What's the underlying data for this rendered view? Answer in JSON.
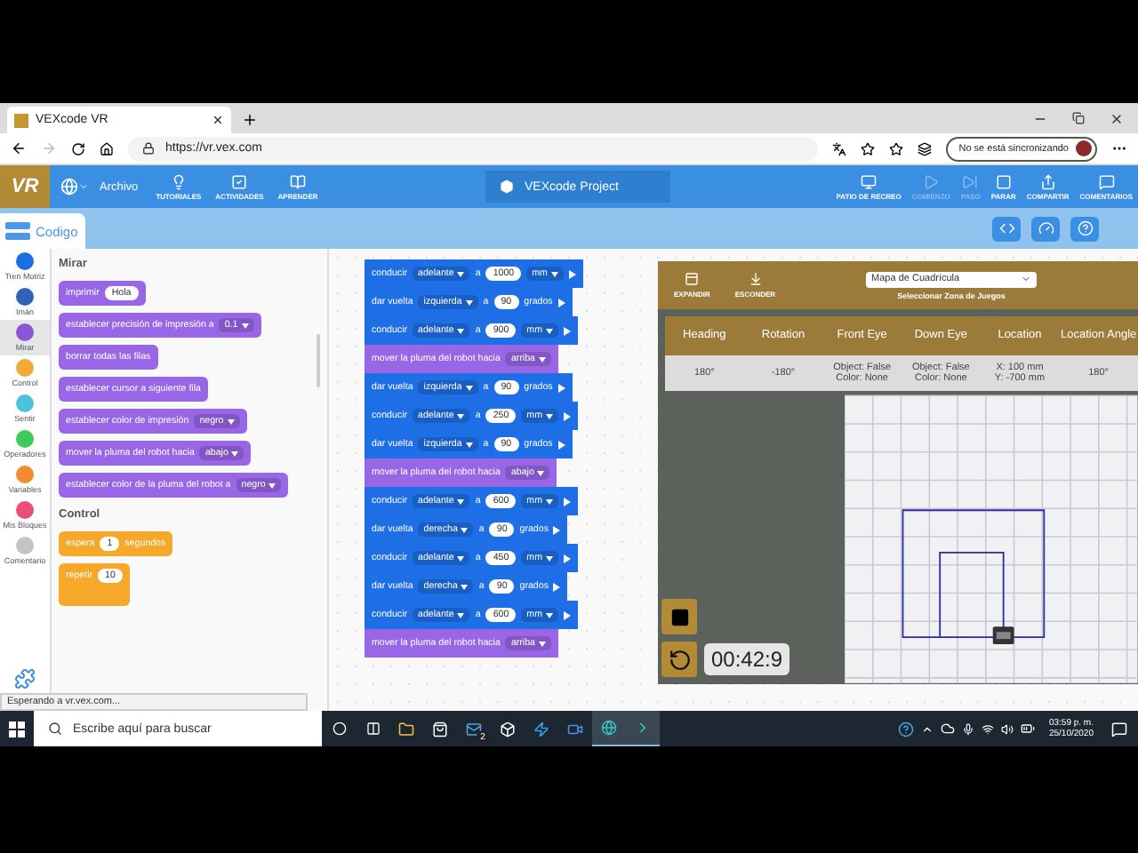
{
  "browser": {
    "tab_title": "VEXcode VR",
    "url": "https://vr.vex.com",
    "sync_label": "No se está sincronizando"
  },
  "toolbar": {
    "logo": "VR",
    "file_menu": "Archivo",
    "nav": [
      {
        "label": "TUTORIALES"
      },
      {
        "label": "ACTIVIDADES"
      },
      {
        "label": "APRENDER"
      }
    ],
    "project": "VEXcode Project",
    "actions": [
      {
        "label": "PATIO DE RECREO",
        "disabled": false
      },
      {
        "label": "COMIENZO",
        "disabled": true
      },
      {
        "label": "PASO",
        "disabled": true
      },
      {
        "label": "PARAR",
        "disabled": false
      },
      {
        "label": "COMPARTIR",
        "disabled": false
      },
      {
        "label": "COMENTARIOS",
        "disabled": false
      }
    ]
  },
  "code_tab": "Codigo",
  "categories": [
    {
      "label": "Tren Motriz",
      "color": "#1c6fe3",
      "selected": false
    },
    {
      "label": "Imán",
      "color": "#2f63b8",
      "selected": false
    },
    {
      "label": "Mirar",
      "color": "#8a55d7",
      "selected": true
    },
    {
      "label": "Control",
      "color": "#f2a93b",
      "selected": false
    },
    {
      "label": "Sentir",
      "color": "#4cc3dc",
      "selected": false
    },
    {
      "label": "Operadores",
      "color": "#3ecb57",
      "selected": false
    },
    {
      "label": "Variables",
      "color": "#f28a2e",
      "selected": false
    },
    {
      "label": "Mis Bloques",
      "color": "#e94f7a",
      "selected": false
    },
    {
      "label": "Comentario",
      "color": "#c4c4c4",
      "selected": false
    }
  ],
  "palette": [
    {
      "title": "Mirar",
      "blocks": [
        {
          "kind": "stack",
          "color": "#9966e6",
          "parts": [
            {
              "kind": "text",
              "text": "imprimir"
            },
            {
              "kind": "input",
              "text": "Hola"
            }
          ]
        },
        {
          "kind": "stack",
          "color": "#9966e6",
          "parts": [
            {
              "kind": "text",
              "text": "establecer precisión de impresión a"
            },
            {
              "kind": "dropdown",
              "text": "0.1"
            }
          ]
        },
        {
          "kind": "stack",
          "color": "#9966e6",
          "parts": [
            {
              "kind": "text",
              "text": "borrar todas las filas"
            }
          ]
        },
        {
          "kind": "stack",
          "color": "#9966e6",
          "parts": [
            {
              "kind": "text",
              "text": "establecer cursor a siguiente fila"
            }
          ]
        },
        {
          "kind": "stack",
          "color": "#9966e6",
          "parts": [
            {
              "kind": "text",
              "text": "establecer color de impresión"
            },
            {
              "kind": "dropdown",
              "text": "negro"
            }
          ]
        },
        {
          "kind": "stack",
          "color": "#9966e6",
          "parts": [
            {
              "kind": "text",
              "text": "mover la pluma del robot hacia"
            },
            {
              "kind": "dropdown",
              "text": "abajo"
            }
          ]
        },
        {
          "kind": "stack",
          "color": "#9966e6",
          "parts": [
            {
              "kind": "text",
              "text": "establecer color de la pluma del robot a"
            },
            {
              "kind": "dropdown",
              "text": "negro"
            }
          ]
        }
      ]
    },
    {
      "title": "Control",
      "blocks": [
        {
          "kind": "stack",
          "color": "#f5a829",
          "parts": [
            {
              "kind": "text",
              "text": "espera"
            },
            {
              "kind": "input",
              "text": "1"
            },
            {
              "kind": "text",
              "text": "segundos"
            }
          ]
        },
        {
          "kind": "c-block",
          "color": "#f5a829",
          "parts": [
            {
              "kind": "text",
              "text": "repetir"
            },
            {
              "kind": "input",
              "text": "10"
            }
          ]
        }
      ]
    }
  ],
  "script": [
    {
      "color": "#1e6fe6",
      "parts": [
        {
          "kind": "text",
          "text": "conducir"
        },
        {
          "kind": "dropdown",
          "text": "adelante"
        },
        {
          "kind": "text",
          "text": "a"
        },
        {
          "kind": "input",
          "text": "1000"
        },
        {
          "kind": "dropdown",
          "text": "mm"
        },
        {
          "kind": "arrow"
        }
      ]
    },
    {
      "color": "#1e6fe6",
      "parts": [
        {
          "kind": "text",
          "text": "dar vuelta"
        },
        {
          "kind": "dropdown",
          "text": "izquierda"
        },
        {
          "kind": "text",
          "text": "a"
        },
        {
          "kind": "input",
          "text": "90"
        },
        {
          "kind": "text",
          "text": "grados"
        },
        {
          "kind": "arrow"
        }
      ]
    },
    {
      "color": "#1e6fe6",
      "parts": [
        {
          "kind": "text",
          "text": "conducir"
        },
        {
          "kind": "dropdown",
          "text": "adelante"
        },
        {
          "kind": "text",
          "text": "a"
        },
        {
          "kind": "input",
          "text": "900"
        },
        {
          "kind": "dropdown",
          "text": "mm"
        },
        {
          "kind": "arrow"
        }
      ]
    },
    {
      "color": "#9966e6",
      "parts": [
        {
          "kind": "text",
          "text": "mover la pluma del robot hacia"
        },
        {
          "kind": "dropdown",
          "text": "arriba"
        }
      ]
    },
    {
      "color": "#1e6fe6",
      "parts": [
        {
          "kind": "text",
          "text": "dar vuelta"
        },
        {
          "kind": "dropdown",
          "text": "izquierda"
        },
        {
          "kind": "text",
          "text": "a"
        },
        {
          "kind": "input",
          "text": "90"
        },
        {
          "kind": "text",
          "text": "grados"
        },
        {
          "kind": "arrow"
        }
      ]
    },
    {
      "color": "#1e6fe6",
      "parts": [
        {
          "kind": "text",
          "text": "conducir"
        },
        {
          "kind": "dropdown",
          "text": "adelante"
        },
        {
          "kind": "text",
          "text": "a"
        },
        {
          "kind": "input",
          "text": "250"
        },
        {
          "kind": "dropdown",
          "text": "mm"
        },
        {
          "kind": "arrow"
        }
      ]
    },
    {
      "color": "#1e6fe6",
      "parts": [
        {
          "kind": "text",
          "text": "dar vuelta"
        },
        {
          "kind": "dropdown",
          "text": "izquierda"
        },
        {
          "kind": "text",
          "text": "a"
        },
        {
          "kind": "input",
          "text": "90"
        },
        {
          "kind": "text",
          "text": "grados"
        },
        {
          "kind": "arrow"
        }
      ]
    },
    {
      "color": "#9966e6",
      "parts": [
        {
          "kind": "text",
          "text": "mover la pluma del robot hacia"
        },
        {
          "kind": "dropdown",
          "text": "abajo"
        }
      ]
    },
    {
      "color": "#1e6fe6",
      "parts": [
        {
          "kind": "text",
          "text": "conducir"
        },
        {
          "kind": "dropdown",
          "text": "adelante"
        },
        {
          "kind": "text",
          "text": "a"
        },
        {
          "kind": "input",
          "text": "600"
        },
        {
          "kind": "dropdown",
          "text": "mm"
        },
        {
          "kind": "arrow"
        }
      ]
    },
    {
      "color": "#1e6fe6",
      "parts": [
        {
          "kind": "text",
          "text": "dar vuelta"
        },
        {
          "kind": "dropdown",
          "text": "derecha"
        },
        {
          "kind": "text",
          "text": "a"
        },
        {
          "kind": "input",
          "text": "90"
        },
        {
          "kind": "text",
          "text": "grados"
        },
        {
          "kind": "arrow"
        }
      ]
    },
    {
      "color": "#1e6fe6",
      "parts": [
        {
          "kind": "text",
          "text": "conducir"
        },
        {
          "kind": "dropdown",
          "text": "adelante"
        },
        {
          "kind": "text",
          "text": "a"
        },
        {
          "kind": "input",
          "text": "450"
        },
        {
          "kind": "dropdown",
          "text": "mm"
        },
        {
          "kind": "arrow"
        }
      ]
    },
    {
      "color": "#1e6fe6",
      "parts": [
        {
          "kind": "text",
          "text": "dar vuelta"
        },
        {
          "kind": "dropdown",
          "text": "derecha"
        },
        {
          "kind": "text",
          "text": "a"
        },
        {
          "kind": "input",
          "text": "90"
        },
        {
          "kind": "text",
          "text": "grados"
        },
        {
          "kind": "arrow"
        }
      ]
    },
    {
      "color": "#1e6fe6",
      "parts": [
        {
          "kind": "text",
          "text": "conducir"
        },
        {
          "kind": "dropdown",
          "text": "adelante"
        },
        {
          "kind": "text",
          "text": "a"
        },
        {
          "kind": "input",
          "text": "600"
        },
        {
          "kind": "dropdown",
          "text": "mm"
        },
        {
          "kind": "arrow"
        }
      ]
    },
    {
      "color": "#9966e6",
      "parts": [
        {
          "kind": "text",
          "text": "mover la pluma del robot hacia"
        },
        {
          "kind": "dropdown",
          "text": "arriba"
        }
      ]
    }
  ],
  "simulator": {
    "expand": "EXPANDIR",
    "hide": "ESCONDER",
    "playground": "Mapa de Cuadrícula",
    "playground_label": "Seleccionar Zona de Juegos",
    "columns": [
      "Heading",
      "Rotation",
      "Front Eye",
      "Down Eye",
      "Location",
      "Location Angle"
    ],
    "values": [
      "180°",
      "-180°",
      "Object: False\nColor: None",
      "Object: False\nColor: None",
      "X: 100 mm\nY: -700 mm",
      "180°"
    ],
    "timer": "00:42:9"
  },
  "status": "Esperando a vr.vex.com...",
  "taskbar": {
    "search_placeholder": "Escribe aquí para buscar",
    "mail_badge": "2",
    "time": "03:59 p. m.",
    "date": "25/10/2020"
  }
}
